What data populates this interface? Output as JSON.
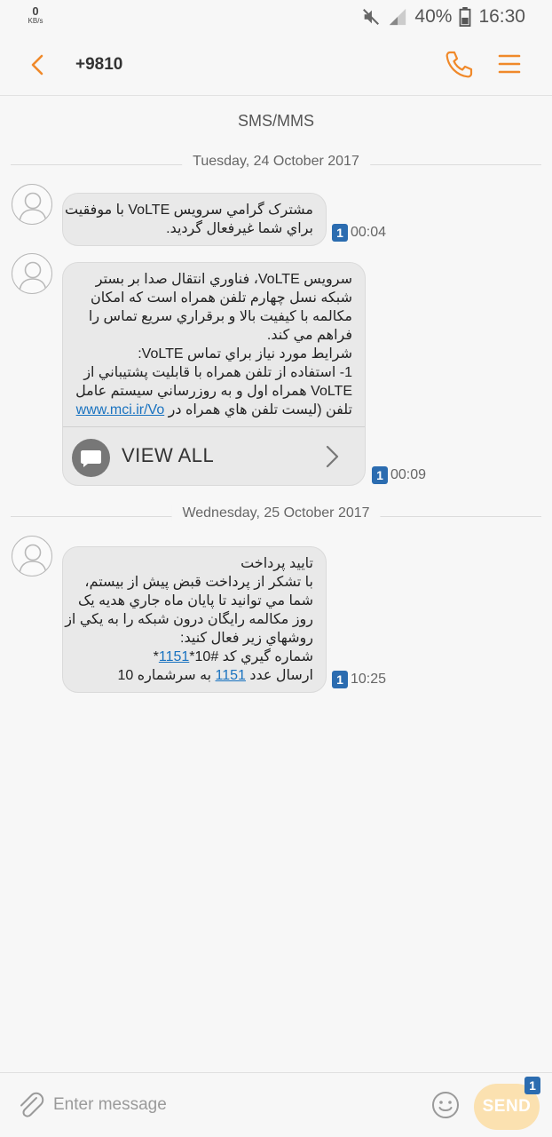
{
  "status_bar": {
    "net_speed_value": "0",
    "net_speed_unit": "KB/s",
    "battery": "40%",
    "time": "16:30"
  },
  "header": {
    "contact": "+9810",
    "icons": [
      "back-icon",
      "phone-icon",
      "menu-icon"
    ]
  },
  "channel_label": "SMS/MMS",
  "dates": {
    "d1": "Tuesday, 24 October 2017",
    "d2": "Wednesday, 25 October 2017"
  },
  "messages": [
    {
      "lines": [
        "مشترک گرامي سرويس VoLTE با موفقيت",
        "براي شما غيرفعال گرديد."
      ],
      "sim": "1",
      "time": "00:04"
    },
    {
      "lines": [
        "سرويس VoLTE، فناوري انتقال صدا بر بستر",
        "شبکه نسل چهارم تلفن همراه است که امکان",
        "مکالمه با کيفيت بالا و برقراري سريع تماس را",
        "فراهم مي کند.",
        "شرايط مورد نياز براي تماس  VoLTE:",
        "1- استفاده از تلفن همراه با قابليت پشتيباني از",
        "VoLTE همراه اول و به روزرساني سيستم عامل",
        "تلفن (ليست تلفن هاي همراه در"
      ],
      "link": "www.mci.ir/Vo",
      "view_all": "VIEW ALL",
      "sim": "1",
      "time": "00:09"
    },
    {
      "lines": [
        "تاييد پرداخت",
        "با تشکر از پرداخت قبض پيش از بيستم،",
        "شما مي توانيد تا پايان ماه جاري  هديه يک",
        "روز مکالمه رايگان درون شبکه را به يکي از",
        "روشهاي زير فعال کنيد:"
      ],
      "line6_a": "شماره گيري کد #10*",
      "line6_link": "1151",
      "line6_b": "*",
      "line7_a": "ارسال عدد ",
      "line7_link": "1151",
      "line7_b": " به سرشماره 10",
      "sim": "1",
      "time": "10:25"
    }
  ],
  "composer": {
    "placeholder": "Enter message",
    "send_label": "SEND",
    "sim": "1"
  },
  "colors": {
    "accent": "#f0892a",
    "sim_badge": "#2b6cb0",
    "link": "#1a73c0",
    "send_bg": "#fbe1b0"
  }
}
